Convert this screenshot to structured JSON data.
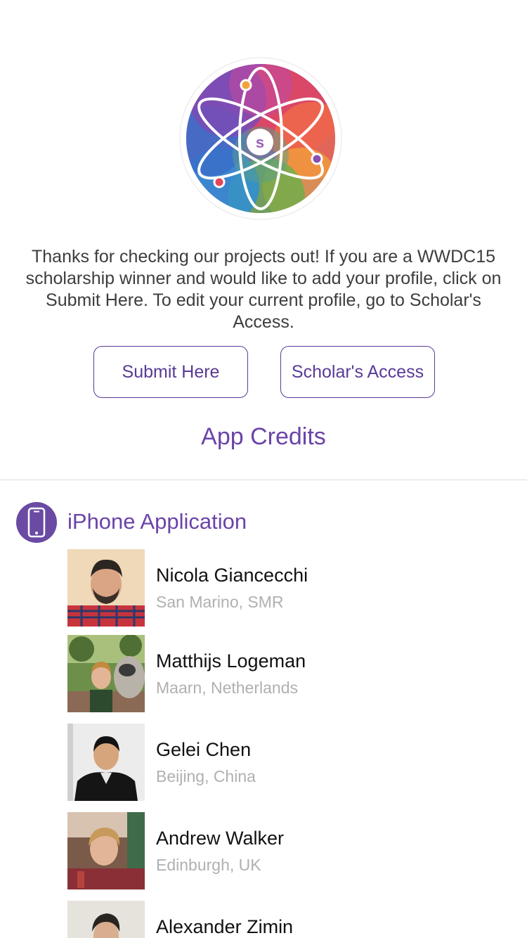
{
  "header": {
    "logo_letter": "s",
    "intro_text": "Thanks for checking our projects out! If you are a WWDC15 scholarship winner and would like to add your profile, click on Submit Here. To edit your current profile, go to Scholar's Access."
  },
  "buttons": {
    "submit_label": "Submit Here",
    "access_label": "Scholar's Access"
  },
  "credits": {
    "title": "App Credits",
    "section": {
      "title": "iPhone Application",
      "icon": "iphone-icon"
    },
    "people": [
      {
        "name": "Nicola Giancecchi",
        "location": "San Marino, SMR"
      },
      {
        "name": "Matthijs Logeman",
        "location": "Maarn, Netherlands"
      },
      {
        "name": "Gelei Chen",
        "location": "Beijing, China"
      },
      {
        "name": "Andrew Walker",
        "location": "Edinburgh, UK"
      },
      {
        "name": "Alexander Zimin",
        "location": ""
      }
    ]
  },
  "colors": {
    "accent": "#6a44a8",
    "button_border": "#5a3a96",
    "location_text": "#b0b0b0"
  }
}
